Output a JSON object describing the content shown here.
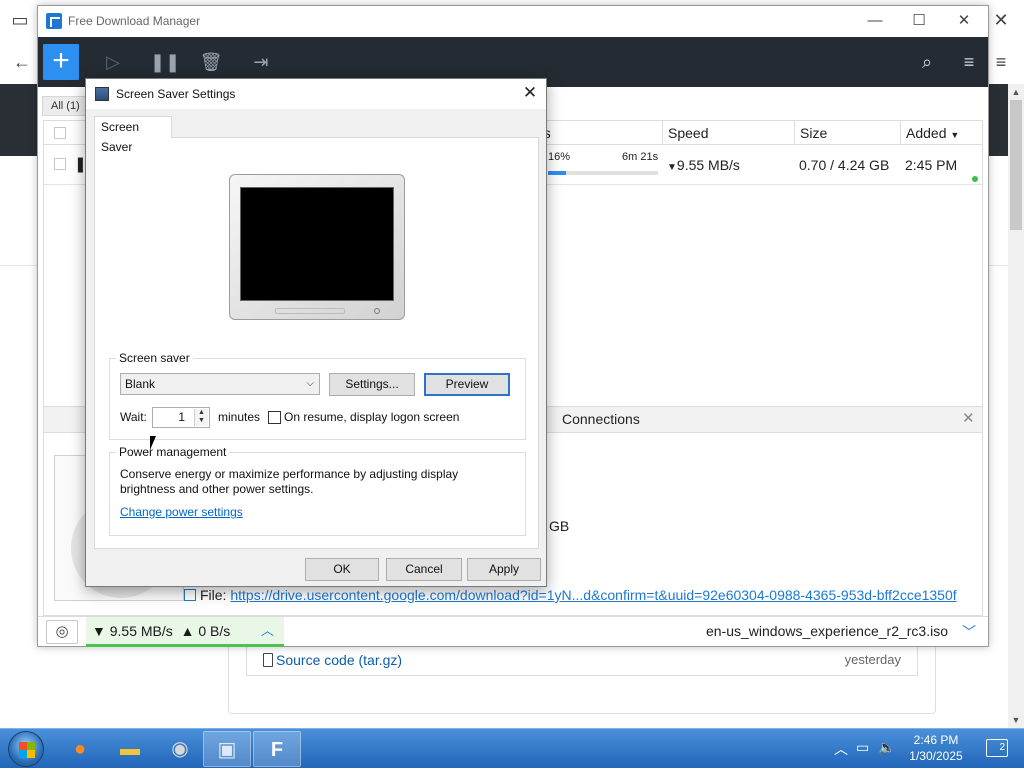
{
  "fdm": {
    "title": "Free Download Manager",
    "all_tab": "All (1)",
    "columns": {
      "status": "Status",
      "speed": "Speed",
      "size": "Size",
      "added": "Added"
    },
    "download": {
      "percent_label": "16%",
      "progress": 0.16,
      "eta": "6m 21s",
      "speed": "9.55 MB/s",
      "size": "0.70 / 4.24 GB",
      "added": "2:45 PM"
    },
    "details": {
      "connections_tab": "Connections",
      "size_fragment": "GB",
      "file_label": "File:",
      "file_url": "https://drive.usercontent.google.com/download?id=1yN...d&confirm=t&uuid=92e60304-0988-4365-953d-bff2cce1350f"
    },
    "statusbar": {
      "down_speed": "9.55 MB/s",
      "up_speed": "0 B/s",
      "file_name": "en-us_windows_experience_r2_rc3.iso"
    }
  },
  "browser": {
    "source_code_label": "Source code",
    "source_code_ext": "(tar.gz)",
    "timestamp": "yesterday"
  },
  "dialog": {
    "title": "Screen Saver Settings",
    "tab": "Screen Saver",
    "screen_saver_group": "Screen saver",
    "screen_saver_value": "Blank",
    "settings_button": "Settings...",
    "preview_button": "Preview",
    "wait_label": "Wait:",
    "wait_value": "1",
    "minutes_label": "minutes",
    "resume_label": "On resume, display logon screen",
    "power_group": "Power management",
    "power_desc": "Conserve energy or maximize performance by adjusting display brightness and other power settings.",
    "power_link": "Change power settings",
    "ok": "OK",
    "cancel": "Cancel",
    "apply": "Apply"
  },
  "taskbar": {
    "time": "2:46 PM",
    "date": "1/30/2025",
    "notification_count": "2"
  },
  "colors": {
    "fdm_toolbar": "#252b33",
    "fdm_accent": "#2d8ff0",
    "speed_green": "#4ec24e",
    "taskbar": "#2166b8",
    "link": "#0066cc"
  },
  "icons": {
    "toolbar": [
      "plus-icon",
      "play-icon",
      "pause-icon",
      "trash-icon",
      "folder-icon",
      "search-icon",
      "menu-icon"
    ],
    "taskbar": [
      "start-orb",
      "firefox-icon",
      "explorer-icon",
      "chrome-icon",
      "screen-saver-icon",
      "fdm-icon"
    ],
    "tray": [
      "chevron-up-icon",
      "network-icon",
      "volume-muted-icon",
      "notification-icon"
    ]
  }
}
